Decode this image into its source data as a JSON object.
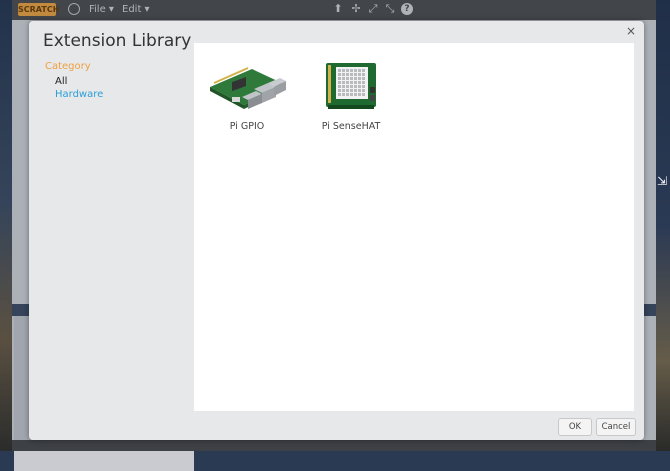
{
  "app": {
    "logo_text": "SCRATCH",
    "menu_file": "File ▾",
    "menu_edit": "Edit ▾",
    "toolbar_icons": [
      "stamp-icon",
      "cut-icon",
      "grow-icon",
      "shrink-icon",
      "help-icon"
    ]
  },
  "dialog": {
    "title": "Extension Library",
    "close_label": "×",
    "category_heading": "Category",
    "categories": [
      {
        "label": "All",
        "selected": true
      },
      {
        "label": "Hardware",
        "selected": false
      }
    ],
    "extensions": [
      {
        "name": "Pi GPIO",
        "icon": "raspberry-pi-board-icon"
      },
      {
        "name": "Pi SenseHAT",
        "icon": "sensehat-board-icon"
      }
    ],
    "ok_label": "OK",
    "cancel_label": "Cancel"
  },
  "colors": {
    "category_heading": "#f0a040",
    "category_link": "#2b9fd8",
    "dialog_bg": "#e6e8e9",
    "content_bg": "#ffffff"
  }
}
